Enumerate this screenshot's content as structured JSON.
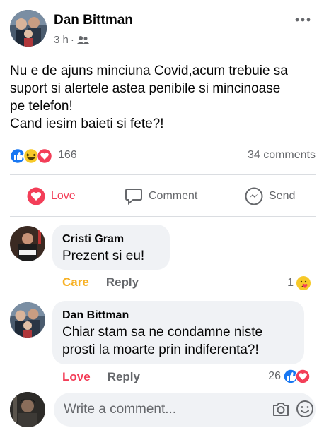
{
  "post": {
    "author": "Dan Bittman",
    "time": "3 h",
    "separator": "·",
    "audience_icon": "friends-icon",
    "text_lines": [
      "Nu e de ajuns minciuna Covid,acum trebuie sa",
      "suport si alertele astea penibile si mincinoase",
      "pe telefon!",
      "Cand iesim baieti si fete?!"
    ],
    "reaction_count": "166",
    "reaction_icons": [
      "like-icon",
      "haha-icon",
      "love-icon"
    ],
    "comments_count": "34 comments"
  },
  "actions": {
    "love_label": "Love",
    "comment_label": "Comment",
    "send_label": "Send"
  },
  "comments": [
    {
      "author": "Cristi Gram",
      "text_lines": [
        "Prezent si eu!"
      ],
      "reaction_label": "Care",
      "reply_label": "Reply",
      "reaction_count": "1",
      "reaction_icon": "care-icon"
    },
    {
      "author": "Dan Bittman",
      "text_lines": [
        "Chiar stam sa ne condamne niste",
        "prosti la moarte prin indiferenta?!"
      ],
      "reaction_label": "Love",
      "reply_label": "Reply",
      "reaction_count": "26",
      "reaction_icons": [
        "like-icon",
        "love-icon"
      ]
    }
  ],
  "composer": {
    "placeholder": "Write a comment..."
  },
  "colors": {
    "love": "#f33e58",
    "care": "#f7b125",
    "like": "#1877f2",
    "secondary_text": "#65676b",
    "bubble": "#f0f2f5"
  }
}
